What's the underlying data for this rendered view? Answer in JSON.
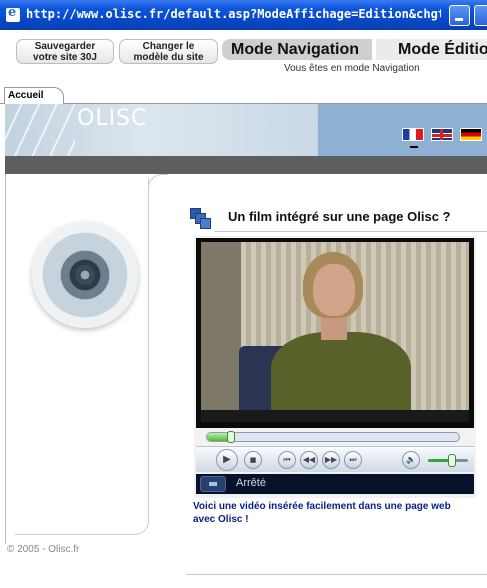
{
  "window": {
    "title": "http://www.olisc.fr/default.asp?ModeAffichage=Edition&chgt_mo..."
  },
  "toolbar": {
    "save_line1": "Sauvegarder",
    "save_line2": "votre site 30J",
    "model_line1": "Changer le",
    "model_line2": "modèle du site",
    "mode_navigation": "Mode Navigation",
    "mode_edition": "Mode Éditio",
    "mode_status": "Vous êtes en mode Navigation"
  },
  "tabs": [
    {
      "label": "Accueil"
    }
  ],
  "banner": {
    "logo_text": "OLISC",
    "languages": [
      "fr",
      "en",
      "de"
    ]
  },
  "content": {
    "heading": "Un film intégré sur une page Olisc ?",
    "caption": "Voici une vidéo insérée facilement dans une page web avec Olisc !",
    "copyright": "© 2005 - Olisc.fr"
  },
  "player": {
    "status": "Arrêté",
    "seek_progress": 0.08,
    "volume_level": 0.6,
    "icons": [
      "play-icon",
      "stop-icon",
      "previous-icon",
      "rewind-icon",
      "fast-forward-icon",
      "next-icon",
      "volume-icon"
    ]
  },
  "colors": {
    "titlebar": "#0a55dd",
    "banner_blue": "#8db0d3",
    "dark_bar": "#5e5e5e",
    "caption_blue": "#0a1f86"
  }
}
